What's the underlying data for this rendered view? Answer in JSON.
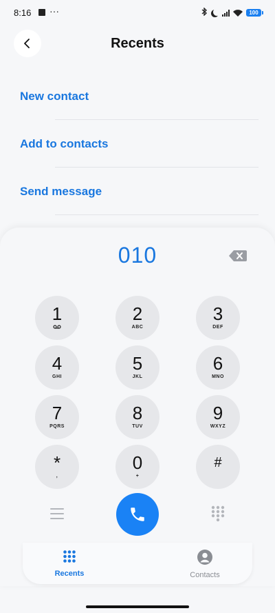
{
  "status_bar": {
    "time": "8:16",
    "more": "···",
    "battery": "100"
  },
  "header": {
    "title": "Recents"
  },
  "actions": [
    {
      "label": "New contact"
    },
    {
      "label": "Add to contacts"
    },
    {
      "label": "Send message"
    }
  ],
  "dialer": {
    "entered_number": "010",
    "keys": [
      {
        "digit": "1",
        "letters": ""
      },
      {
        "digit": "2",
        "letters": "ABC"
      },
      {
        "digit": "3",
        "letters": "DEF"
      },
      {
        "digit": "4",
        "letters": "GHI"
      },
      {
        "digit": "5",
        "letters": "JKL"
      },
      {
        "digit": "6",
        "letters": "MNO"
      },
      {
        "digit": "7",
        "letters": "PQRS"
      },
      {
        "digit": "8",
        "letters": "TUV"
      },
      {
        "digit": "9",
        "letters": "WXYZ"
      },
      {
        "digit": "*",
        "letters": ","
      },
      {
        "digit": "0",
        "letters": "+"
      },
      {
        "digit": "#",
        "letters": ""
      }
    ]
  },
  "bottom_nav": {
    "recents_label": "Recents",
    "contacts_label": "Contacts",
    "active": "recents",
    "accent_color": "#1977df",
    "inactive_color": "#8a8d93"
  },
  "icons": {
    "back": "chevron-left-icon",
    "delete": "backspace-icon",
    "menu": "hamburger-icon",
    "call": "phone-icon",
    "dialpad": "dialpad-grid-icon",
    "recents": "grid-dots-icon",
    "contacts": "person-icon"
  }
}
